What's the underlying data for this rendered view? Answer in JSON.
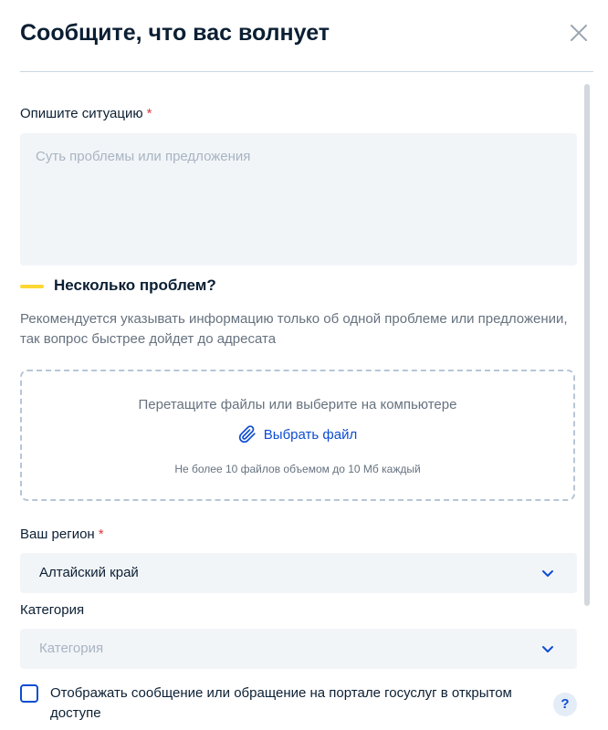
{
  "dialog": {
    "title": "Сообщите, что вас волнует"
  },
  "description": {
    "label": "Опишите ситуацию",
    "required_mark": "*",
    "placeholder": "Суть проблемы или предложения",
    "value": ""
  },
  "notice": {
    "title": "Несколько проблем?",
    "text": "Рекомендуется указывать информацию только об одной проблеме или предложении, так вопрос быстрее дойдет до адресата",
    "accent_color": "#fdd733"
  },
  "upload": {
    "prompt": "Перетащите файлы или выберите на компьютере",
    "link_label": "Выбрать файл",
    "limit_text": "Не более 10 файлов объемом до 10 Мб каждый",
    "link_icon": "paperclip-icon"
  },
  "region": {
    "label": "Ваш регион",
    "required_mark": "*",
    "value": "Алтайский край"
  },
  "category": {
    "label": "Категория",
    "placeholder": "Категория",
    "value": ""
  },
  "public_display": {
    "label": "Отображать сообщение или обращение на портале госуслуг в открытом доступе",
    "checked": false
  },
  "help": {
    "label": "?"
  },
  "colors": {
    "primary": "#0d4cd3",
    "required": "#e0393e",
    "field_bg": "#f2f5f8",
    "text": "#0b1f33",
    "muted": "#66727f"
  }
}
